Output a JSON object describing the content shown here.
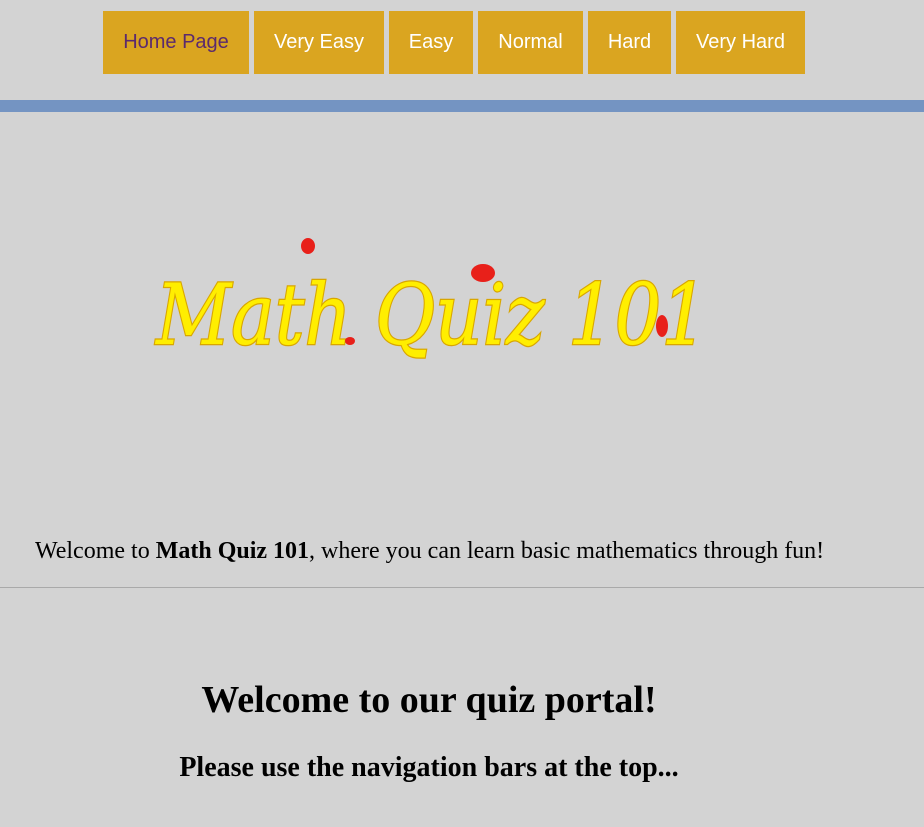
{
  "nav": {
    "items": [
      {
        "label": "Home Page",
        "active": true
      },
      {
        "label": "Very Easy"
      },
      {
        "label": "Easy"
      },
      {
        "label": "Normal"
      },
      {
        "label": "Hard"
      },
      {
        "label": "Very Hard"
      }
    ]
  },
  "logo": {
    "text": "Math Quiz 101",
    "fill_color": "#ffee00",
    "accent_color": "#e8201a"
  },
  "intro": {
    "prefix": "Welcome to ",
    "brand": "Math Quiz 101",
    "suffix": ", where you can learn basic mathematics through fun!"
  },
  "main": {
    "title": "Welcome to our quiz portal!",
    "subtitle": "Please use the navigation bars at the top..."
  },
  "colors": {
    "background": "#d3d3d3",
    "nav_button": "#daa520",
    "nav_active_text": "#5b2a6e",
    "divider_bar": "#7494c2"
  }
}
